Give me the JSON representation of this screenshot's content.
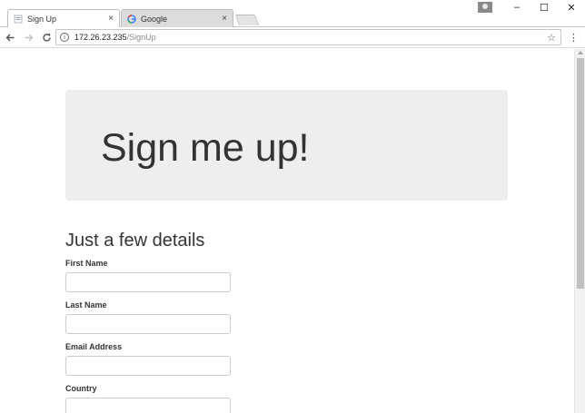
{
  "browser": {
    "tabs": [
      {
        "label": "Sign Up",
        "active": true
      },
      {
        "label": "Google",
        "active": false
      }
    ],
    "tab_close_glyph": "×",
    "address": {
      "host": "172.26.23.235",
      "path": "/SignUp"
    },
    "window_controls": {
      "minimize": "–",
      "maximize": "☐",
      "close": "✕"
    }
  },
  "page": {
    "jumbotron_title": "Sign me up!",
    "form_heading": "Just a few details",
    "fields": [
      {
        "label": "First Name",
        "value": ""
      },
      {
        "label": "Last Name",
        "value": ""
      },
      {
        "label": "Email Address",
        "value": ""
      },
      {
        "label": "Country",
        "value": ""
      }
    ]
  },
  "colors": {
    "jumbotron_bg": "#eeeeee",
    "text": "#333333",
    "input_border": "#cccccc"
  },
  "icons": [
    "sign-up-favicon-icon",
    "google-favicon-icon",
    "back-arrow-icon",
    "forward-arrow-icon",
    "reload-icon",
    "info-icon",
    "bookmark-star-icon",
    "menu-dots-icon",
    "profile-icon"
  ]
}
